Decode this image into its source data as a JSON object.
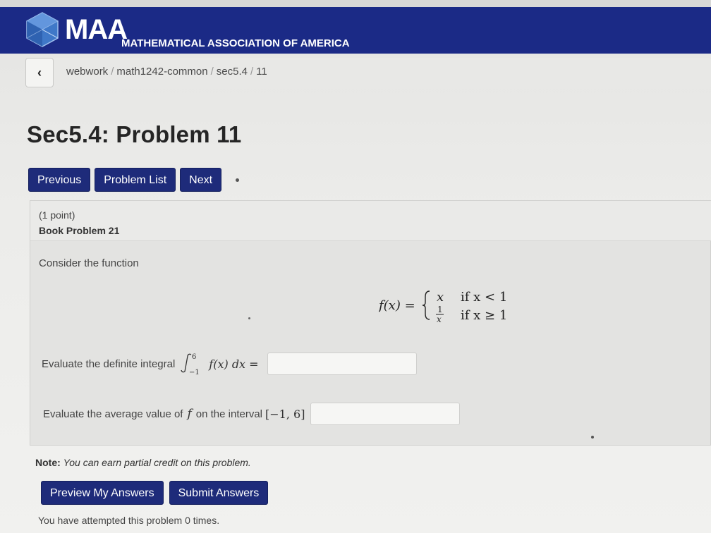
{
  "header": {
    "logo_text": "MAA",
    "logo_subtitle": "MATHEMATICAL ASSOCIATION OF AMERICA",
    "brand_color": "#1b2a86"
  },
  "breadcrumb": {
    "back_icon": "chevron-left-icon",
    "items": [
      "webwork",
      "math1242-common",
      "sec5.4",
      "11"
    ],
    "separator": "/"
  },
  "page_title": "Sec5.4: Problem 11",
  "nav": {
    "previous_label": "Previous",
    "problem_list_label": "Problem List",
    "next_label": "Next",
    "button_color": "#1e2b7a"
  },
  "problem": {
    "points": "(1 point)",
    "book_problem": "Book Problem 21",
    "intro": "Consider the function",
    "formula": {
      "lhs": "f(x) =",
      "case1_expr": "x",
      "case1_cond": "if x < 1",
      "case2_num": "1",
      "case2_den": "x",
      "case2_cond": "if x ≥ 1"
    },
    "q1_text": "Evaluate the definite integral",
    "q1_integral_upper": "6",
    "q1_integral_lower": "−1",
    "q1_integrand": "f(x) dx =",
    "q1_value": "",
    "q2_text": "Evaluate the average value of",
    "q2_f": "f",
    "q2_on": "on the interval",
    "q2_interval": "[−1, 6]",
    "q2_value": ""
  },
  "note": {
    "label": "Note:",
    "text": "You can earn partial credit on this problem."
  },
  "actions": {
    "preview_label": "Preview My Answers",
    "submit_label": "Submit Answers"
  },
  "status": {
    "attempted_prefix": "You have attempted this problem",
    "attempts": "0",
    "attempted_suffix": "times."
  }
}
